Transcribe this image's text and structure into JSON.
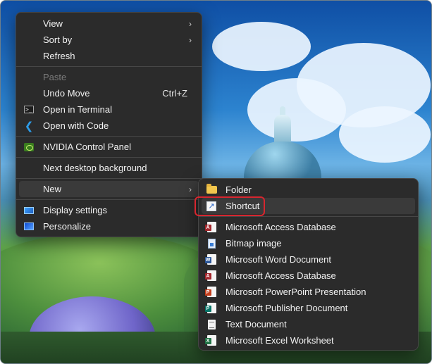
{
  "main_menu": {
    "items": [
      {
        "label": "View",
        "icon": "",
        "shortcut": "",
        "submenu": true,
        "disabled": false
      },
      {
        "label": "Sort by",
        "icon": "",
        "shortcut": "",
        "submenu": true,
        "disabled": false
      },
      {
        "label": "Refresh",
        "icon": "",
        "shortcut": "",
        "submenu": false,
        "disabled": false
      },
      {
        "label": "Paste",
        "icon": "",
        "shortcut": "",
        "submenu": false,
        "disabled": true
      },
      {
        "label": "Undo Move",
        "icon": "",
        "shortcut": "Ctrl+Z",
        "submenu": false,
        "disabled": false
      },
      {
        "label": "Open in Terminal",
        "icon": "terminal-icon",
        "shortcut": "",
        "submenu": false,
        "disabled": false
      },
      {
        "label": "Open with Code",
        "icon": "vscode-icon",
        "shortcut": "",
        "submenu": false,
        "disabled": false
      },
      {
        "label": "NVIDIA Control Panel",
        "icon": "nvidia-icon",
        "shortcut": "",
        "submenu": false,
        "disabled": false
      },
      {
        "label": "Next desktop background",
        "icon": "",
        "shortcut": "",
        "submenu": false,
        "disabled": false
      },
      {
        "label": "New",
        "icon": "",
        "shortcut": "",
        "submenu": true,
        "disabled": false
      },
      {
        "label": "Display settings",
        "icon": "display-icon",
        "shortcut": "",
        "submenu": false,
        "disabled": false
      },
      {
        "label": "Personalize",
        "icon": "personalize-icon",
        "shortcut": "",
        "submenu": false,
        "disabled": false
      }
    ],
    "chevron": "›"
  },
  "new_submenu": {
    "items": [
      {
        "label": "Folder",
        "icon": "folder-icon"
      },
      {
        "label": "Shortcut",
        "icon": "shortcut-icon",
        "highlighted": true
      },
      {
        "label": "Microsoft Access Database",
        "icon": "access-icon",
        "tag": "A",
        "color": "#a4262c"
      },
      {
        "label": "Bitmap image",
        "icon": "bitmap-icon"
      },
      {
        "label": "Microsoft Word Document",
        "icon": "word-icon",
        "tag": "W",
        "color": "#2b579a"
      },
      {
        "label": "Microsoft Access Database",
        "icon": "access-icon",
        "tag": "A",
        "color": "#a4262c"
      },
      {
        "label": "Microsoft PowerPoint Presentation",
        "icon": "powerpoint-icon",
        "tag": "P",
        "color": "#c43e1c"
      },
      {
        "label": "Microsoft Publisher Document",
        "icon": "publisher-icon",
        "tag": "P",
        "color": "#077568"
      },
      {
        "label": "Text Document",
        "icon": "text-document-icon"
      },
      {
        "label": "Microsoft Excel Worksheet",
        "icon": "excel-icon",
        "tag": "X",
        "color": "#217346"
      }
    ],
    "shortcut_arrow": "↗"
  },
  "colors": {
    "menu_bg": "#2b2b2b",
    "highlight_border": "#d7262f"
  }
}
